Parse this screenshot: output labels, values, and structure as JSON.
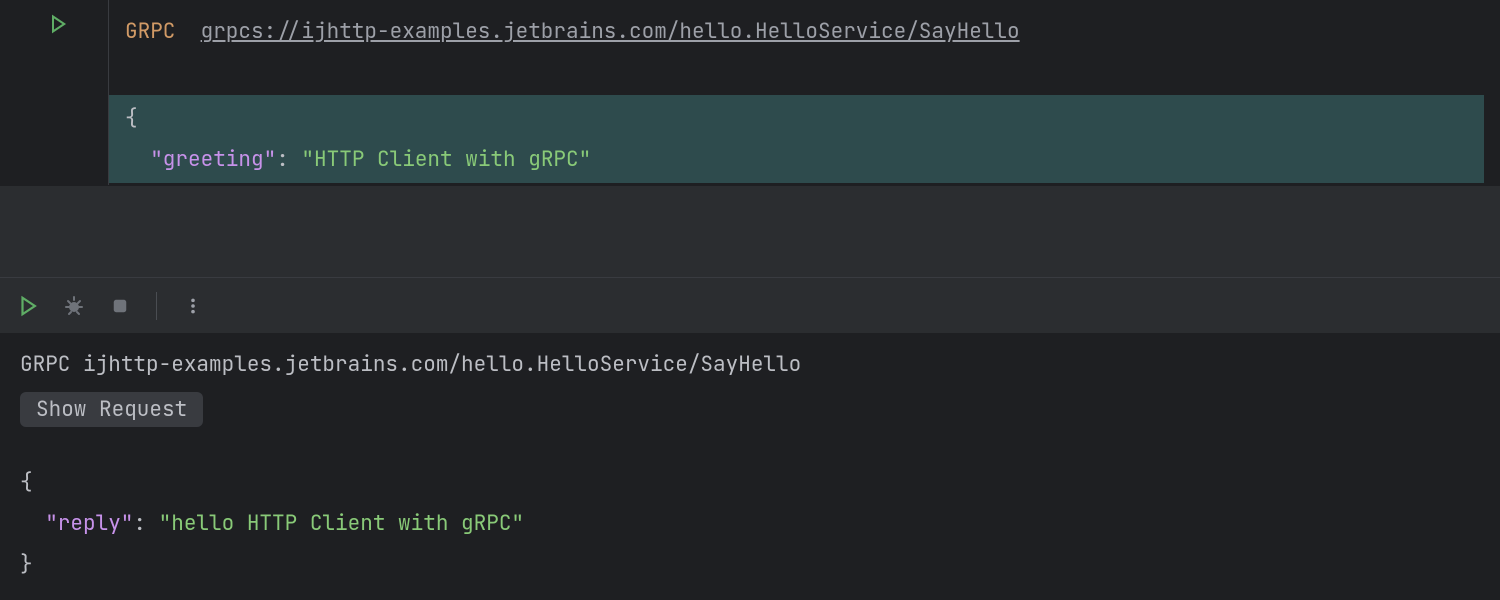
{
  "editor": {
    "method": "GRPC",
    "url": "grpcs://ijhttp-examples.jetbrains.com/hello.HelloService/SayHello",
    "body": {
      "open": "{",
      "key": "\"greeting\"",
      "colon": ":",
      "value": "\"HTTP Client with gRPC\""
    }
  },
  "output": {
    "header_method": "GRPC",
    "header_target": "ijhttp-examples.jetbrains.com/hello.HelloService/SayHello",
    "show_request_label": "Show Request",
    "response": {
      "open": "{",
      "key": "\"reply\"",
      "colon": ":",
      "value": "\"hello HTTP Client with gRPC\"",
      "close": "}"
    }
  }
}
